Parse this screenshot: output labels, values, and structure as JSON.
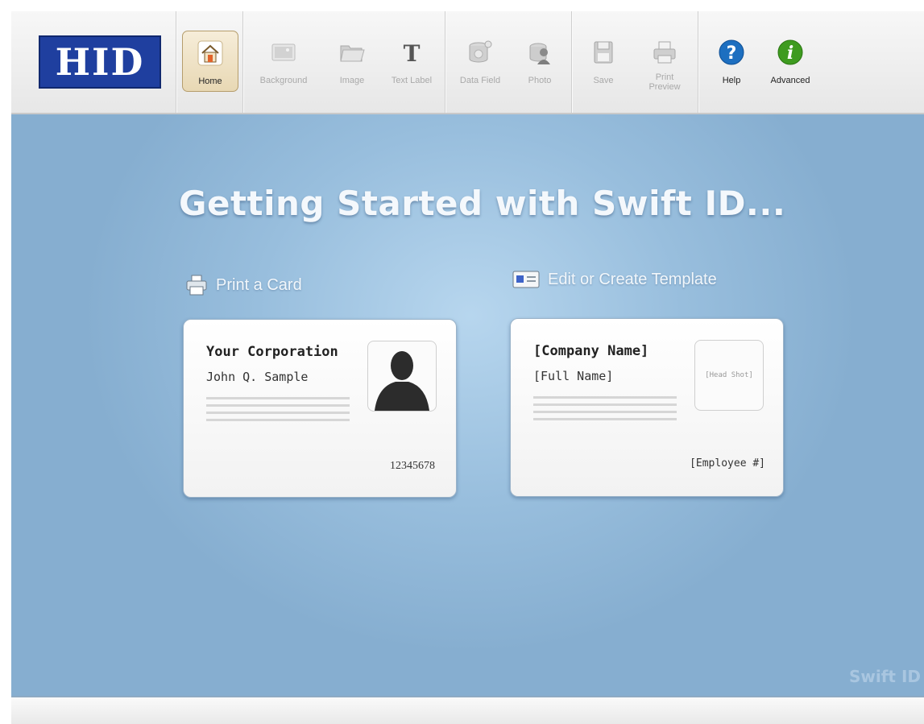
{
  "brand": {
    "logo_text": "HID",
    "color": "#1f3f9f"
  },
  "toolbar": {
    "home": {
      "label": "Home",
      "icon": "home-icon"
    },
    "background": {
      "label": "Background",
      "icon": "background-icon"
    },
    "image": {
      "label": "Image",
      "icon": "folder-image-icon"
    },
    "text_label": {
      "label": "Text Label",
      "icon": "text-T-icon"
    },
    "data_field": {
      "label": "Data Field",
      "icon": "database-icon"
    },
    "photo": {
      "label": "Photo",
      "icon": "person-photo-icon"
    },
    "save": {
      "label": "Save",
      "icon": "floppy-disk-icon"
    },
    "print_preview": {
      "label": "Print\nPreview",
      "icon": "printer-icon"
    },
    "help": {
      "label": "Help",
      "icon": "question-icon",
      "color": "#1d6fc0"
    },
    "advanced": {
      "label": "Advanced",
      "icon": "info-icon",
      "color": "#3e9b1f"
    }
  },
  "main": {
    "headline": "Getting Started with Swift ID...",
    "print_card": {
      "label": "Print a Card",
      "icon": "printer-icon"
    },
    "edit_template": {
      "label": "Edit or Create Template",
      "icon": "id-card-icon"
    },
    "sample_card": {
      "company": "Your Corporation",
      "name": "John Q. Sample",
      "number": "12345678"
    },
    "template_card": {
      "company": "[Company Name]",
      "name": "[Full Name]",
      "head_shot": "[Head Shot]",
      "employee": "[Employee #]"
    },
    "watermark": "Swift ID"
  }
}
